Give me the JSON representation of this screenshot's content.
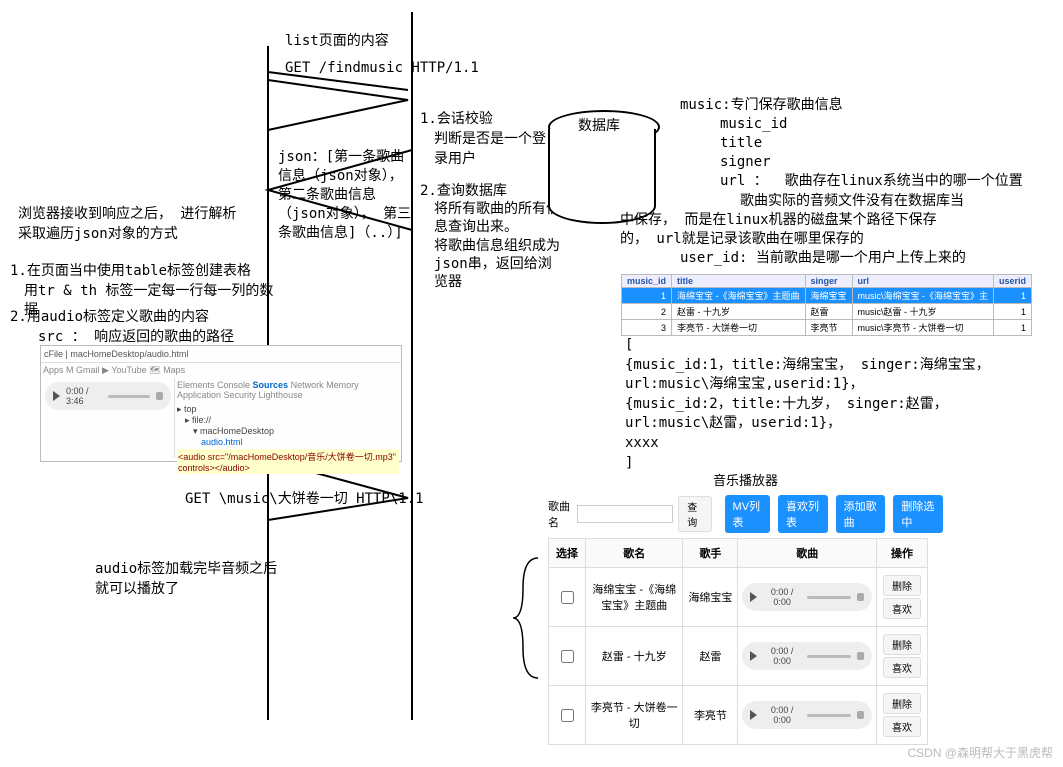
{
  "seq": {
    "top_label": "list页面的内容",
    "http_get": "GET /findmusic HTTP/1.1",
    "json_msg": "json：[第一条歌曲信息（json对象），  第二条歌曲信息（json对象），  第三条歌曲信息]（..）]",
    "http_music": "GET \\music\\大饼卷一切 HTTP\\1.1",
    "audio_done1": "audio标签加载完毕音频之后",
    "audio_done2": "就可以播放了"
  },
  "server": {
    "step1_t": "1.会话校验",
    "step1_b": "判断是否是一个登录用户",
    "step2_t": "2.查询数据库",
    "step2_b1": "将所有歌曲的所有信息查询出来。",
    "step2_b2": "将歌曲信息组织成为json串，返回给浏览器",
    "db_label": "数据库"
  },
  "left": {
    "l1": "浏览器接收到响应之后，  进行解析",
    "l2": "采取遍历json对象的方式",
    "p1a": "1.在页面当中使用table标签创建表格",
    "p1b": "用tr & th 标签一定每一行每一列的数据",
    "p2a": "2.用audio标签定义歌曲的内容",
    "p2b": "src ： 响应返回的歌曲的路径"
  },
  "music_schema": {
    "title": "music:专门保存歌曲信息",
    "f1": "music_id",
    "f2": "title",
    "f3": "signer",
    "url_label": "url ：",
    "url_desc": "歌曲存在linux系统当中的哪一个位置",
    "url_l1": "歌曲实际的音频文件没有在数据库当",
    "url_l2": "中保存，  而是在linux机器的磁盘某个路径下保存",
    "url_l3": "的，  url就是记录该歌曲在哪里保存的",
    "userid": "user_id: 当前歌曲是哪一个用户上传上来的"
  },
  "db_table": {
    "cols": [
      "music_id",
      "title",
      "singer",
      "url",
      "userid"
    ],
    "rows": [
      [
        "1",
        "海绵宝宝 -《海绵宝宝》主题曲",
        "海绵宝宝",
        "music\\海绵宝宝 -《海绵宝宝》主",
        "1"
      ],
      [
        "2",
        "赵雷 - 十九岁",
        "赵雷",
        "music\\赵雷 - 十九岁",
        "1"
      ],
      [
        "3",
        "李亮节 - 大饼卷一切",
        "李亮节",
        "music\\李亮节 - 大饼卷一切",
        "1"
      ]
    ]
  },
  "json_sample": {
    "l0": "[",
    "l1": "{music_id:1，title:海绵宝宝，  singer:海绵宝宝，  url:music\\海绵宝宝,userid:1}，",
    "l2": "{music_id:2，title:十九岁，  singer:赵雷，  url:music\\赵雷，userid:1}，",
    "l3": "xxxx",
    "l4": "]"
  },
  "player": {
    "title": "音乐播放器",
    "search_label": "歌曲名",
    "search_ph": "",
    "search_btn": "查询",
    "b1": "MV列表",
    "b2": "喜欢列表",
    "b3": "添加歌曲",
    "b4": "删除选中",
    "th": [
      "选择",
      "歌名",
      "歌手",
      "歌曲",
      "操作"
    ],
    "rows": [
      {
        "name": "海绵宝宝 -《海绵宝宝》主题曲",
        "singer": "海绵宝宝",
        "time": "0:00 / 0:00"
      },
      {
        "name": "赵雷 - 十九岁",
        "singer": "赵雷",
        "time": "0:00 / 0:00"
      },
      {
        "name": "李亮节 - 大饼卷一切",
        "singer": "李亮节",
        "time": "0:00 / 0:00"
      }
    ],
    "del": "删除",
    "fav": "喜欢"
  },
  "watermark": "CSDN @森明帮大于黑虎帮"
}
